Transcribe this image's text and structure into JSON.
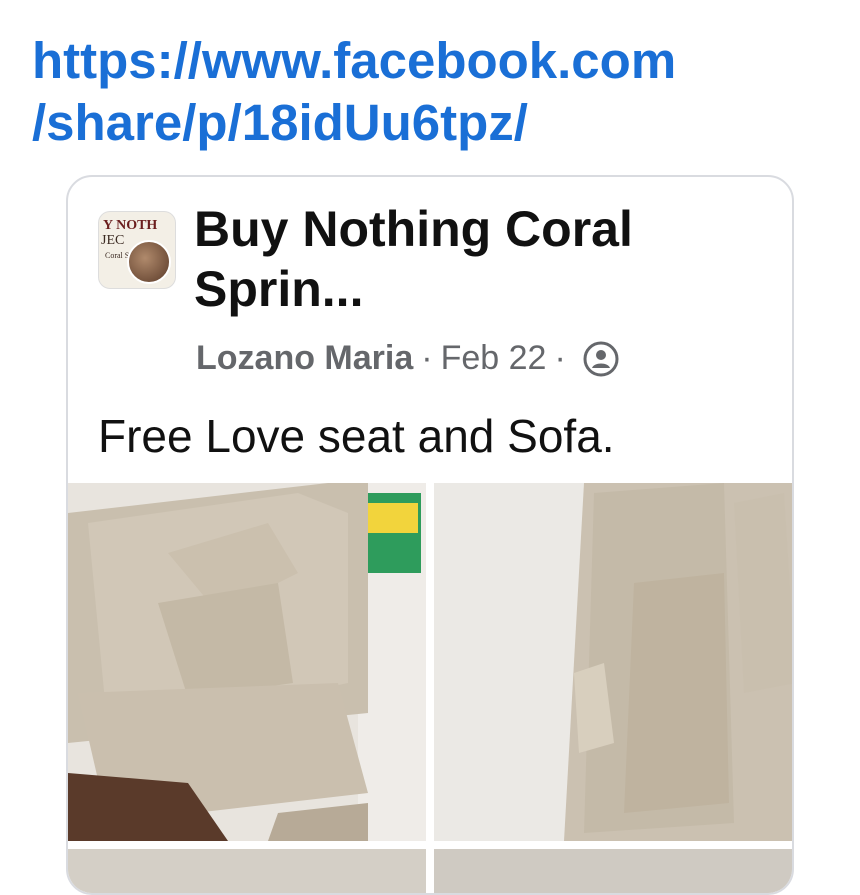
{
  "share_link": {
    "line1": "https://www.facebook.com",
    "line2": "/share/p/18idUu6tpz/"
  },
  "post": {
    "group_name": "Buy Nothing Coral Sprin...",
    "author": "Lozano Maria",
    "date": "Feb 22",
    "separator": "·",
    "privacy_icon": "people-icon",
    "text": "Free Love seat and Sofa."
  },
  "avatar": {
    "logo_lines": [
      "Y NOTH",
      "JEC",
      "Coral Springs"
    ]
  }
}
